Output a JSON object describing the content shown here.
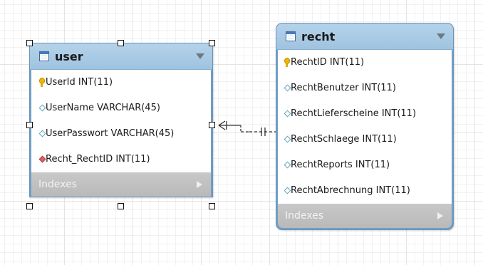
{
  "tables": [
    {
      "name": "user",
      "columns": [
        {
          "icon": "key",
          "text": "UserId INT(11)"
        },
        {
          "icon": "diamond",
          "text": "UserName VARCHAR(45)"
        },
        {
          "icon": "diamond",
          "text": "UserPasswort VARCHAR(45)"
        },
        {
          "icon": "fk",
          "text": "Recht_RechtID INT(11)"
        }
      ],
      "footer": "Indexes"
    },
    {
      "name": "recht",
      "columns": [
        {
          "icon": "key",
          "text": "RechtID INT(11)"
        },
        {
          "icon": "diamond",
          "text": "RechtBenutzer INT(11)"
        },
        {
          "icon": "diamond",
          "text": "RechtLieferscheine INT(11)"
        },
        {
          "icon": "diamond",
          "text": "RechtSchlaege INT(11)"
        },
        {
          "icon": "diamond",
          "text": "RechtReports INT(11)"
        },
        {
          "icon": "diamond",
          "text": "RechtAbrechnung INT(11)"
        }
      ],
      "footer": "Indexes"
    }
  ],
  "colors": {
    "header": "#a8cbe6",
    "border": "#6f9fc8",
    "footer": "#bfbfbf",
    "primary_key": "#f0b800",
    "foreign_key": "#e06060"
  },
  "selection": {
    "selected_table": "user"
  }
}
